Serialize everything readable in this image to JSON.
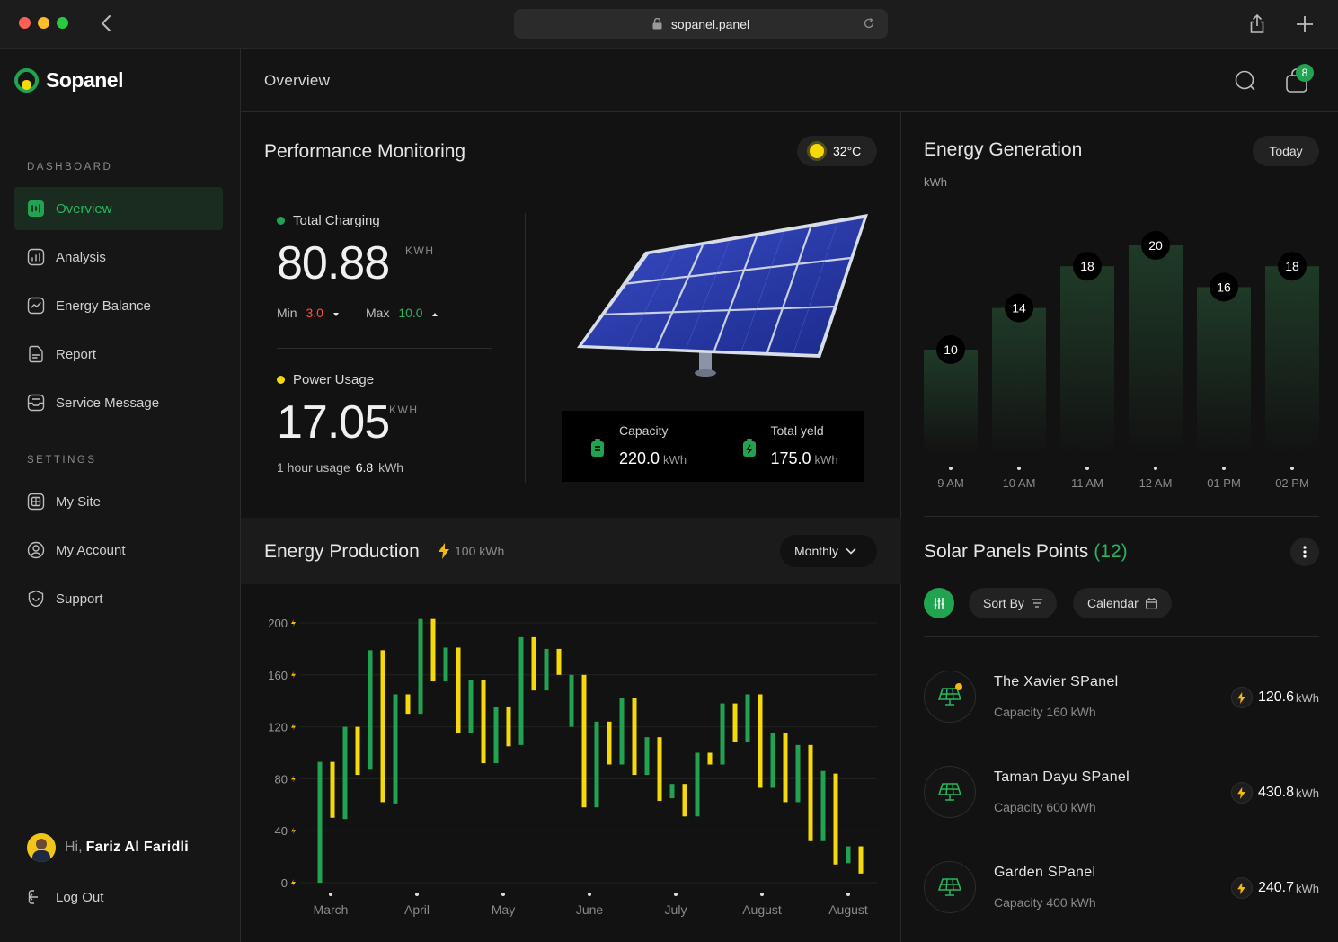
{
  "browser": {
    "url": "sopanel.panel"
  },
  "app": {
    "name": "Sopanel"
  },
  "sidebar": {
    "sections": [
      {
        "title": "DASHBOARD",
        "items": [
          {
            "label": "Overview",
            "icon": "overview-icon",
            "active": true
          },
          {
            "label": "Analysis",
            "icon": "analysis-icon"
          },
          {
            "label": "Energy Balance",
            "icon": "energy-balance-icon"
          },
          {
            "label": "Report",
            "icon": "report-icon"
          },
          {
            "label": "Service Message",
            "icon": "service-message-icon"
          }
        ]
      },
      {
        "title": "SETTINGS",
        "items": [
          {
            "label": "My Site",
            "icon": "site-icon"
          },
          {
            "label": "My Account",
            "icon": "account-icon"
          },
          {
            "label": "Support",
            "icon": "support-icon"
          }
        ]
      }
    ],
    "user": {
      "greeting": "Hi,",
      "name": "Fariz Al Faridli"
    },
    "logout_label": "Log Out"
  },
  "header": {
    "title": "Overview",
    "notification_count": "8"
  },
  "performance": {
    "title": "Performance Monitoring",
    "temperature": "32°C",
    "total_charging": {
      "label": "Total Charging",
      "value": "80.88",
      "unit": "KWH",
      "min_label": "Min",
      "min_value": "3.0",
      "max_label": "Max",
      "max_value": "10.0"
    },
    "power_usage": {
      "label": "Power Usage",
      "value": "17.05",
      "unit": "KWH",
      "usage_label": "1 hour usage",
      "usage_value": "6.8",
      "usage_unit": "kWh"
    },
    "capacity": {
      "label": "Capacity",
      "value": "220.0",
      "unit": "kWh"
    },
    "total_yield": {
      "label": "Total yeld",
      "value": "175.0",
      "unit": "kWh"
    }
  },
  "production": {
    "title": "Energy Production",
    "tag": "100 kWh",
    "period": "Monthly"
  },
  "generation": {
    "title": "Energy Generation",
    "unit": "kWh",
    "period": "Today"
  },
  "points": {
    "title": "Solar Panels Points",
    "count": "(12)",
    "sort_label": "Sort By",
    "calendar_label": "Calendar",
    "items": [
      {
        "name": "The Xavier SPanel",
        "capacity": "Capacity 160 kWh",
        "value": "120.6",
        "unit": "kWh"
      },
      {
        "name": "Taman Dayu SPanel",
        "capacity": "Capacity 600 kWh",
        "value": "430.8",
        "unit": "kWh"
      },
      {
        "name": "Garden SPanel",
        "capacity": "Capacity 400 kWh",
        "value": "240.7",
        "unit": "kWh"
      }
    ]
  },
  "colors": {
    "accent_green": "#22a352",
    "accent_yellow": "#f5d90a",
    "background": "#121212"
  },
  "chart_data": [
    {
      "type": "bar",
      "title": "Energy Generation",
      "ylabel": "kWh",
      "categories": [
        "9 AM",
        "10 AM",
        "11 AM",
        "12 AM",
        "01 PM",
        "02 PM"
      ],
      "values": [
        10,
        14,
        18,
        20,
        16,
        18
      ],
      "ylim": [
        0,
        25
      ]
    },
    {
      "type": "candlestick",
      "title": "Energy Production",
      "ylim": [
        0,
        200
      ],
      "yticks": [
        200,
        160,
        120,
        80,
        40,
        0
      ],
      "xticks": [
        "March",
        "April",
        "May",
        "June",
        "July",
        "August",
        "August"
      ],
      "colors": {
        "green": "#22a352",
        "yellow": "#f5d90a"
      },
      "bars": [
        {
          "low": 0,
          "high": 93,
          "color": "green"
        },
        {
          "low": 50,
          "high": 93,
          "color": "yellow"
        },
        {
          "low": 49,
          "high": 120,
          "color": "green"
        },
        {
          "low": 83,
          "high": 120,
          "color": "yellow"
        },
        {
          "low": 87,
          "high": 179,
          "color": "green"
        },
        {
          "low": 62,
          "high": 179,
          "color": "yellow"
        },
        {
          "low": 61,
          "high": 145,
          "color": "green"
        },
        {
          "low": 130,
          "high": 145,
          "color": "yellow"
        },
        {
          "low": 130,
          "high": 203,
          "color": "green"
        },
        {
          "low": 155,
          "high": 203,
          "color": "yellow"
        },
        {
          "low": 155,
          "high": 181,
          "color": "green"
        },
        {
          "low": 115,
          "high": 181,
          "color": "yellow"
        },
        {
          "low": 115,
          "high": 156,
          "color": "green"
        },
        {
          "low": 92,
          "high": 156,
          "color": "yellow"
        },
        {
          "low": 92,
          "high": 135,
          "color": "green"
        },
        {
          "low": 105,
          "high": 135,
          "color": "yellow"
        },
        {
          "low": 106,
          "high": 189,
          "color": "green"
        },
        {
          "low": 148,
          "high": 189,
          "color": "yellow"
        },
        {
          "low": 148,
          "high": 180,
          "color": "green"
        },
        {
          "low": 160,
          "high": 180,
          "color": "yellow"
        },
        {
          "low": 120,
          "high": 160,
          "color": "green"
        },
        {
          "low": 58,
          "high": 160,
          "color": "yellow"
        },
        {
          "low": 58,
          "high": 124,
          "color": "green"
        },
        {
          "low": 91,
          "high": 124,
          "color": "yellow"
        },
        {
          "low": 91,
          "high": 142,
          "color": "green"
        },
        {
          "low": 83,
          "high": 142,
          "color": "yellow"
        },
        {
          "low": 83,
          "high": 112,
          "color": "green"
        },
        {
          "low": 63,
          "high": 112,
          "color": "yellow"
        },
        {
          "low": 65,
          "high": 76,
          "color": "green"
        },
        {
          "low": 51,
          "high": 76,
          "color": "yellow"
        },
        {
          "low": 51,
          "high": 100,
          "color": "green"
        },
        {
          "low": 91,
          "high": 100,
          "color": "yellow"
        },
        {
          "low": 91,
          "high": 138,
          "color": "green"
        },
        {
          "low": 108,
          "high": 138,
          "color": "yellow"
        },
        {
          "low": 108,
          "high": 145,
          "color": "green"
        },
        {
          "low": 73,
          "high": 145,
          "color": "yellow"
        },
        {
          "low": 73,
          "high": 115,
          "color": "green"
        },
        {
          "low": 62,
          "high": 115,
          "color": "yellow"
        },
        {
          "low": 62,
          "high": 106,
          "color": "green"
        },
        {
          "low": 32,
          "high": 106,
          "color": "yellow"
        },
        {
          "low": 32,
          "high": 86,
          "color": "green"
        },
        {
          "low": 14,
          "high": 84,
          "color": "yellow"
        },
        {
          "low": 15,
          "high": 28,
          "color": "green"
        },
        {
          "low": 7,
          "high": 28,
          "color": "yellow"
        }
      ]
    }
  ]
}
